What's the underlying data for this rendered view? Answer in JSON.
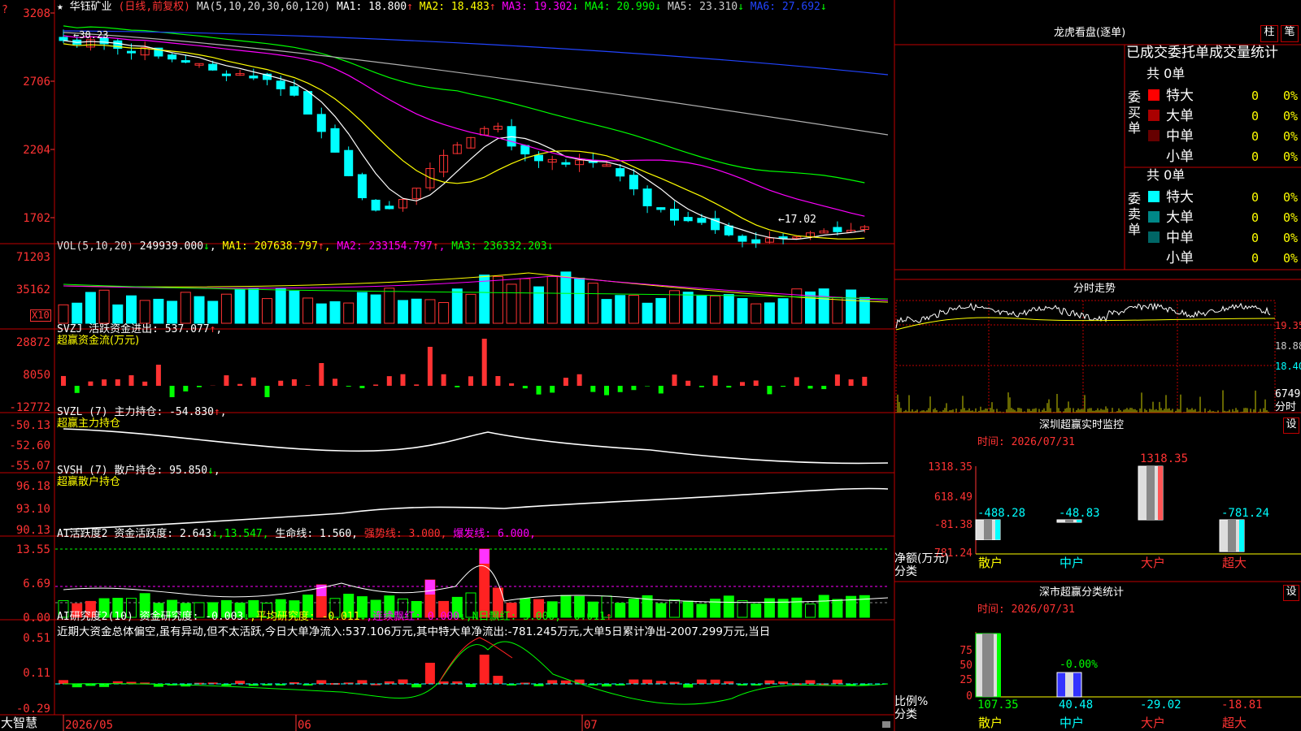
{
  "colors": {
    "up": "#ff3333",
    "down": "#00ffff",
    "bg": "#000000",
    "frame": "#c00000",
    "green": "#00ff00",
    "yellow": "#ffff00",
    "magenta": "#ff00ff",
    "white": "#ffffff",
    "blue": "#2244ff",
    "gray": "#b0b0b0",
    "axis": "#ff3333"
  },
  "kline": {
    "title_star": "★",
    "stock_name": "华钰矿业",
    "mode": "(日线,前复权)",
    "ma_label": "MA(5,10,20,30,60,120)",
    "ma": [
      {
        "text": "MA1: 18.800",
        "arrow": "↑",
        "color": "#ffffff"
      },
      {
        "text": "MA2: 18.483",
        "arrow": "↑",
        "color": "#ffff00"
      },
      {
        "text": "MA3: 19.302",
        "arrow": "↓",
        "color": "#ff00ff"
      },
      {
        "text": "MA4: 20.990",
        "arrow": "↓",
        "color": "#00ff00"
      },
      {
        "text": "MA5: 23.310",
        "arrow": "↓",
        "color": "#cccccc"
      },
      {
        "text": "MA6: 27.692",
        "arrow": "↓",
        "color": "#2244ff"
      }
    ],
    "y_ticks": [
      "3208",
      "2706",
      "2204",
      "1702"
    ],
    "high_label": "←30.23",
    "low_label": "←17.02"
  },
  "vol": {
    "header_label": "VOL(5,10,20)",
    "value": "249939.000",
    "arrow": "↓",
    "ma": [
      {
        "text": "MA1: 207638.797",
        "arrow": "↑",
        "color": "#ffff00"
      },
      {
        "text": "MA2: 233154.797",
        "arrow": "↑",
        "color": "#ff00ff"
      },
      {
        "text": "MA3: 236332.203",
        "arrow": "↓",
        "color": "#00ff00"
      }
    ],
    "y_ticks": [
      "71203",
      "35162"
    ],
    "unit": "X10"
  },
  "svzj": {
    "line1_label": "SVZJ  活跃资金进出:",
    "line1_value": "537.077",
    "line1_arrow": "↑",
    "line1_end": ",",
    "line2": "超赢资金流(万元)",
    "y_ticks": [
      "28872",
      "8050",
      "-12772"
    ]
  },
  "svzl": {
    "label": "SVZL (7) 主力持仓:",
    "value": "-54.830",
    "arrow": "↑",
    "end": ",",
    "line2": "超赢主力持仓",
    "y_ticks": [
      "-50.13",
      "-52.60",
      "-55.07"
    ]
  },
  "svsh": {
    "label": "SVSH (7) 散户持仓:",
    "value": "95.850",
    "arrow": "↓",
    "end": ",",
    "line2": "超赢散户持仓",
    "y_ticks": [
      "96.18",
      "93.10",
      "90.13"
    ]
  },
  "ai1": {
    "label": "AI活跃度2 资金活跃度:",
    "v1": "2.643",
    "a1": "↓",
    "v2": ",13.547,",
    "v3": "生命线: 1.560,",
    "v4": "强势线: 3.000,",
    "v5": "爆发线: 6.000,",
    "y_ticks": [
      "13.55",
      "6.69",
      "0.00"
    ]
  },
  "ai2": {
    "label": "AI研究度2(10) 资金研究度:",
    "v1": "-0.003",
    "a1": "↓",
    "v2": ",平均研究度: -0.011",
    "a2": "↓",
    "v3": ",连续飘红: 0.000",
    "a3": "↓",
    "v4": ",N日飘红: 3.000, -0.011",
    "a4": "↑",
    "text": "近期大资金总体偏空,虽有异动,但不太活跃,今日大单净流入:537.106万元,其中特大单净流出:-781.245万元,大单5日累计净出-2007.299万元,当日",
    "y_ticks": [
      "0.51",
      "0.11",
      "-0.29"
    ]
  },
  "xaxis": {
    "logo": "大智慧",
    "labels": [
      "2026/05",
      "06",
      "07"
    ]
  },
  "lhb": {
    "title": "龙虎看盘(逐单)",
    "btn1": "柱",
    "btn2": "笔",
    "header": "已成交委托单成交量统计",
    "buy": {
      "side": [
        "委",
        "买",
        "单"
      ],
      "total": "共 0单",
      "rows": [
        {
          "name": "特大",
          "val": "0",
          "pct": "0%",
          "color": "#ff0000"
        },
        {
          "name": "大单",
          "val": "0",
          "pct": "0%",
          "color": "#aa0000"
        },
        {
          "name": "中单",
          "val": "0",
          "pct": "0%",
          "color": "#660000"
        },
        {
          "name": "小单",
          "val": "0",
          "pct": "0%",
          "color": "#000000"
        }
      ]
    },
    "sell": {
      "side": [
        "委",
        "卖",
        "单"
      ],
      "total": "共 0单",
      "rows": [
        {
          "name": "特大",
          "val": "0",
          "pct": "0%",
          "color": "#00ffff"
        },
        {
          "name": "大单",
          "val": "0",
          "pct": "0%",
          "color": "#008888"
        },
        {
          "name": "中单",
          "val": "0",
          "pct": "0%",
          "color": "#006666"
        },
        {
          "name": "小单",
          "val": "0",
          "pct": "0%",
          "color": "#000000"
        }
      ]
    }
  },
  "intraday": {
    "title": "分时走势",
    "price_ticks": [
      "19.35",
      "18.88",
      "18.40"
    ],
    "vol_ticks": [
      "6749",
      "分时"
    ]
  },
  "sz_monitor": {
    "title": "深圳超赢实时监控",
    "btn": "设",
    "date": "时间: 2026/07/31",
    "y_ticks": [
      "1318.35",
      "618.49",
      "-81.38",
      "-781.24"
    ],
    "side_label": "净额(万元)",
    "cat_label": "分类",
    "categories": [
      "散户",
      "中户",
      "大户",
      "超大"
    ],
    "values": [
      -488.28,
      -48.83,
      1318.35,
      -781.24
    ],
    "value_labels": [
      "-488.28",
      "-48.83",
      "1318.35",
      "-781.24"
    ]
  },
  "sz_stats": {
    "title": "深市超赢分类统计",
    "btn": "设",
    "date": "时间: 2026/07/31",
    "y_ticks": [
      "75",
      "50",
      "25",
      "0"
    ],
    "zero_label": "-0.00%",
    "side_label": "比例%",
    "cat_label": "分类",
    "categories": [
      "散户",
      "中户",
      "大户",
      "超大"
    ],
    "values": [
      107.35,
      40.48,
      -29.02,
      -18.81
    ],
    "value_labels": [
      "107.35",
      "40.48",
      "-29.02",
      "-18.81"
    ]
  }
}
